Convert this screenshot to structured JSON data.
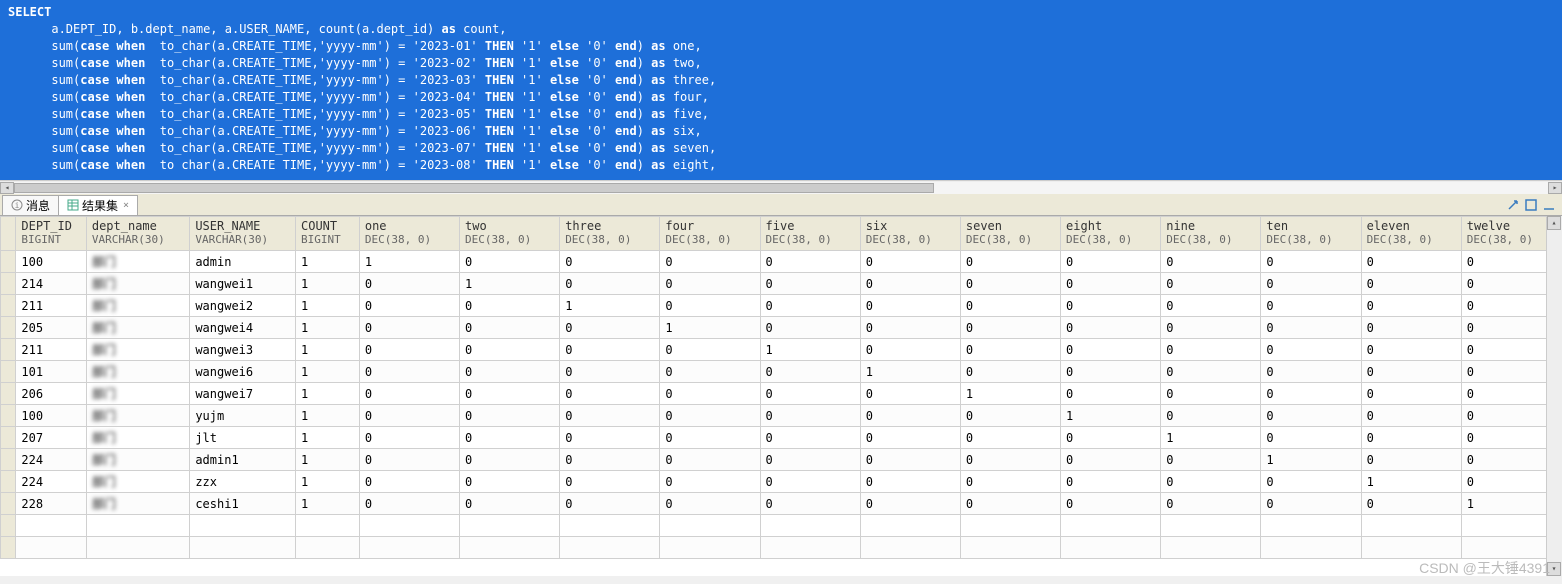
{
  "sql": {
    "lines": [
      {
        "indent": 0,
        "segs": [
          {
            "t": "SELECT",
            "kw": true
          }
        ]
      },
      {
        "indent": 1,
        "segs": [
          {
            "t": "a.DEPT_ID, b.dept_name, a.USER_NAME, count(a.dept_id) "
          },
          {
            "t": "as",
            "kw": true
          },
          {
            "t": " count,"
          }
        ]
      },
      {
        "indent": 1,
        "segs": [
          {
            "t": "sum("
          },
          {
            "t": "case when",
            "kw": true
          },
          {
            "t": "  to_char(a.CREATE_TIME,"
          },
          {
            "t": "'yyyy-mm'",
            "str": true
          },
          {
            "t": ") = "
          },
          {
            "t": "'2023-01'",
            "str": true
          },
          {
            "t": " "
          },
          {
            "t": "THEN",
            "kw": true
          },
          {
            "t": " "
          },
          {
            "t": "'1'",
            "str": true
          },
          {
            "t": " "
          },
          {
            "t": "else",
            "kw": true
          },
          {
            "t": " "
          },
          {
            "t": "'0'",
            "str": true
          },
          {
            "t": " "
          },
          {
            "t": "end",
            "kw": true
          },
          {
            "t": ") "
          },
          {
            "t": "as",
            "kw": true
          },
          {
            "t": " one,"
          }
        ]
      },
      {
        "indent": 1,
        "segs": [
          {
            "t": "sum("
          },
          {
            "t": "case when",
            "kw": true
          },
          {
            "t": "  to_char(a.CREATE_TIME,"
          },
          {
            "t": "'yyyy-mm'",
            "str": true
          },
          {
            "t": ") = "
          },
          {
            "t": "'2023-02'",
            "str": true
          },
          {
            "t": " "
          },
          {
            "t": "THEN",
            "kw": true
          },
          {
            "t": " "
          },
          {
            "t": "'1'",
            "str": true
          },
          {
            "t": " "
          },
          {
            "t": "else",
            "kw": true
          },
          {
            "t": " "
          },
          {
            "t": "'0'",
            "str": true
          },
          {
            "t": " "
          },
          {
            "t": "end",
            "kw": true
          },
          {
            "t": ") "
          },
          {
            "t": "as",
            "kw": true
          },
          {
            "t": " two,"
          }
        ]
      },
      {
        "indent": 1,
        "segs": [
          {
            "t": "sum("
          },
          {
            "t": "case when",
            "kw": true
          },
          {
            "t": "  to_char(a.CREATE_TIME,"
          },
          {
            "t": "'yyyy-mm'",
            "str": true
          },
          {
            "t": ") = "
          },
          {
            "t": "'2023-03'",
            "str": true
          },
          {
            "t": " "
          },
          {
            "t": "THEN",
            "kw": true
          },
          {
            "t": " "
          },
          {
            "t": "'1'",
            "str": true
          },
          {
            "t": " "
          },
          {
            "t": "else",
            "kw": true
          },
          {
            "t": " "
          },
          {
            "t": "'0'",
            "str": true
          },
          {
            "t": " "
          },
          {
            "t": "end",
            "kw": true
          },
          {
            "t": ") "
          },
          {
            "t": "as",
            "kw": true
          },
          {
            "t": " three,"
          }
        ]
      },
      {
        "indent": 1,
        "segs": [
          {
            "t": "sum("
          },
          {
            "t": "case when",
            "kw": true
          },
          {
            "t": "  to_char(a.CREATE_TIME,"
          },
          {
            "t": "'yyyy-mm'",
            "str": true
          },
          {
            "t": ") = "
          },
          {
            "t": "'2023-04'",
            "str": true
          },
          {
            "t": " "
          },
          {
            "t": "THEN",
            "kw": true
          },
          {
            "t": " "
          },
          {
            "t": "'1'",
            "str": true
          },
          {
            "t": " "
          },
          {
            "t": "else",
            "kw": true
          },
          {
            "t": " "
          },
          {
            "t": "'0'",
            "str": true
          },
          {
            "t": " "
          },
          {
            "t": "end",
            "kw": true
          },
          {
            "t": ") "
          },
          {
            "t": "as",
            "kw": true
          },
          {
            "t": " four,"
          }
        ]
      },
      {
        "indent": 1,
        "segs": [
          {
            "t": "sum("
          },
          {
            "t": "case when",
            "kw": true
          },
          {
            "t": "  to_char(a.CREATE_TIME,"
          },
          {
            "t": "'yyyy-mm'",
            "str": true
          },
          {
            "t": ") = "
          },
          {
            "t": "'2023-05'",
            "str": true
          },
          {
            "t": " "
          },
          {
            "t": "THEN",
            "kw": true
          },
          {
            "t": " "
          },
          {
            "t": "'1'",
            "str": true
          },
          {
            "t": " "
          },
          {
            "t": "else",
            "kw": true
          },
          {
            "t": " "
          },
          {
            "t": "'0'",
            "str": true
          },
          {
            "t": " "
          },
          {
            "t": "end",
            "kw": true
          },
          {
            "t": ") "
          },
          {
            "t": "as",
            "kw": true
          },
          {
            "t": " five,"
          }
        ]
      },
      {
        "indent": 1,
        "segs": [
          {
            "t": "sum("
          },
          {
            "t": "case when",
            "kw": true
          },
          {
            "t": "  to_char(a.CREATE_TIME,"
          },
          {
            "t": "'yyyy-mm'",
            "str": true
          },
          {
            "t": ") = "
          },
          {
            "t": "'2023-06'",
            "str": true
          },
          {
            "t": " "
          },
          {
            "t": "THEN",
            "kw": true
          },
          {
            "t": " "
          },
          {
            "t": "'1'",
            "str": true
          },
          {
            "t": " "
          },
          {
            "t": "else",
            "kw": true
          },
          {
            "t": " "
          },
          {
            "t": "'0'",
            "str": true
          },
          {
            "t": " "
          },
          {
            "t": "end",
            "kw": true
          },
          {
            "t": ") "
          },
          {
            "t": "as",
            "kw": true
          },
          {
            "t": " six,"
          }
        ]
      },
      {
        "indent": 1,
        "segs": [
          {
            "t": "sum("
          },
          {
            "t": "case when",
            "kw": true
          },
          {
            "t": "  to_char(a.CREATE_TIME,"
          },
          {
            "t": "'yyyy-mm'",
            "str": true
          },
          {
            "t": ") = "
          },
          {
            "t": "'2023-07'",
            "str": true
          },
          {
            "t": " "
          },
          {
            "t": "THEN",
            "kw": true
          },
          {
            "t": " "
          },
          {
            "t": "'1'",
            "str": true
          },
          {
            "t": " "
          },
          {
            "t": "else",
            "kw": true
          },
          {
            "t": " "
          },
          {
            "t": "'0'",
            "str": true
          },
          {
            "t": " "
          },
          {
            "t": "end",
            "kw": true
          },
          {
            "t": ") "
          },
          {
            "t": "as",
            "kw": true
          },
          {
            "t": " seven,"
          }
        ]
      },
      {
        "indent": 1,
        "segs": [
          {
            "t": "sum("
          },
          {
            "t": "case when",
            "kw": true
          },
          {
            "t": "  to char(a.CREATE TIME,"
          },
          {
            "t": "'yyyy-mm'",
            "str": true
          },
          {
            "t": ") = "
          },
          {
            "t": "'2023-08'",
            "str": true
          },
          {
            "t": " "
          },
          {
            "t": "THEN",
            "kw": true
          },
          {
            "t": " "
          },
          {
            "t": "'1'",
            "str": true
          },
          {
            "t": " "
          },
          {
            "t": "else",
            "kw": true
          },
          {
            "t": " "
          },
          {
            "t": "'0'",
            "str": true
          },
          {
            "t": " "
          },
          {
            "t": "end",
            "kw": true
          },
          {
            "t": ") "
          },
          {
            "t": "as",
            "kw": true
          },
          {
            "t": " eight,"
          }
        ]
      }
    ]
  },
  "tabs": {
    "items": [
      {
        "label": "消息",
        "active": false,
        "icon": "info-icon"
      },
      {
        "label": "结果集",
        "active": true,
        "icon": "grid-icon",
        "closable": true
      }
    ]
  },
  "grid": {
    "columns": [
      {
        "name": "DEPT_ID",
        "type": "BIGINT",
        "cls": "c-dept"
      },
      {
        "name": "dept_name",
        "type": "VARCHAR(30)",
        "cls": "c-dname"
      },
      {
        "name": "USER_NAME",
        "type": "VARCHAR(30)",
        "cls": "c-uname"
      },
      {
        "name": "COUNT",
        "type": "BIGINT",
        "cls": "c-count"
      },
      {
        "name": "one",
        "type": "DEC(38, 0)",
        "cls": "c-mon"
      },
      {
        "name": "two",
        "type": "DEC(38, 0)",
        "cls": "c-mon"
      },
      {
        "name": "three",
        "type": "DEC(38, 0)",
        "cls": "c-mon"
      },
      {
        "name": "four",
        "type": "DEC(38, 0)",
        "cls": "c-mon"
      },
      {
        "name": "five",
        "type": "DEC(38, 0)",
        "cls": "c-mon"
      },
      {
        "name": "six",
        "type": "DEC(38, 0)",
        "cls": "c-mon"
      },
      {
        "name": "seven",
        "type": "DEC(38, 0)",
        "cls": "c-mon"
      },
      {
        "name": "eight",
        "type": "DEC(38, 0)",
        "cls": "c-mon"
      },
      {
        "name": "nine",
        "type": "DEC(38, 0)",
        "cls": "c-mon"
      },
      {
        "name": "ten",
        "type": "DEC(38, 0)",
        "cls": "c-mon"
      },
      {
        "name": "eleven",
        "type": "DEC(38, 0)",
        "cls": "c-mon"
      },
      {
        "name": "twelve",
        "type": "DEC(38, 0)",
        "cls": "c-mon"
      }
    ],
    "rows": [
      {
        "dept_id": "100",
        "dept_name": "",
        "user_name": "admin",
        "count": "1",
        "m": [
          "1",
          "0",
          "0",
          "0",
          "0",
          "0",
          "0",
          "0",
          "0",
          "0",
          "0",
          "0"
        ]
      },
      {
        "dept_id": "214",
        "dept_name": "",
        "user_name": "wangwei1",
        "count": "1",
        "m": [
          "0",
          "1",
          "0",
          "0",
          "0",
          "0",
          "0",
          "0",
          "0",
          "0",
          "0",
          "0"
        ]
      },
      {
        "dept_id": "211",
        "dept_name": "",
        "user_name": "wangwei2",
        "count": "1",
        "m": [
          "0",
          "0",
          "1",
          "0",
          "0",
          "0",
          "0",
          "0",
          "0",
          "0",
          "0",
          "0"
        ]
      },
      {
        "dept_id": "205",
        "dept_name": "",
        "user_name": "wangwei4",
        "count": "1",
        "m": [
          "0",
          "0",
          "0",
          "1",
          "0",
          "0",
          "0",
          "0",
          "0",
          "0",
          "0",
          "0"
        ]
      },
      {
        "dept_id": "211",
        "dept_name": "",
        "user_name": "wangwei3",
        "count": "1",
        "m": [
          "0",
          "0",
          "0",
          "0",
          "1",
          "0",
          "0",
          "0",
          "0",
          "0",
          "0",
          "0"
        ]
      },
      {
        "dept_id": "101",
        "dept_name": "",
        "user_name": "wangwei6",
        "count": "1",
        "m": [
          "0",
          "0",
          "0",
          "0",
          "0",
          "1",
          "0",
          "0",
          "0",
          "0",
          "0",
          "0"
        ]
      },
      {
        "dept_id": "206",
        "dept_name": "",
        "user_name": "wangwei7",
        "count": "1",
        "m": [
          "0",
          "0",
          "0",
          "0",
          "0",
          "0",
          "1",
          "0",
          "0",
          "0",
          "0",
          "0"
        ]
      },
      {
        "dept_id": "100",
        "dept_name": "",
        "user_name": "yujm",
        "count": "1",
        "m": [
          "0",
          "0",
          "0",
          "0",
          "0",
          "0",
          "0",
          "1",
          "0",
          "0",
          "0",
          "0"
        ]
      },
      {
        "dept_id": "207",
        "dept_name": "",
        "user_name": "jlt",
        "count": "1",
        "m": [
          "0",
          "0",
          "0",
          "0",
          "0",
          "0",
          "0",
          "0",
          "1",
          "0",
          "0",
          "0"
        ]
      },
      {
        "dept_id": "224",
        "dept_name": "",
        "user_name": "admin1",
        "count": "1",
        "m": [
          "0",
          "0",
          "0",
          "0",
          "0",
          "0",
          "0",
          "0",
          "0",
          "1",
          "0",
          "0"
        ]
      },
      {
        "dept_id": "224",
        "dept_name": "",
        "user_name": "zzx",
        "count": "1",
        "m": [
          "0",
          "0",
          "0",
          "0",
          "0",
          "0",
          "0",
          "0",
          "0",
          "0",
          "1",
          "0"
        ]
      },
      {
        "dept_id": "228",
        "dept_name": "",
        "user_name": "ceshi1",
        "count": "1",
        "m": [
          "0",
          "0",
          "0",
          "0",
          "0",
          "0",
          "0",
          "0",
          "0",
          "0",
          "0",
          "1"
        ]
      }
    ]
  },
  "watermark": "CSDN @王大锤4391"
}
